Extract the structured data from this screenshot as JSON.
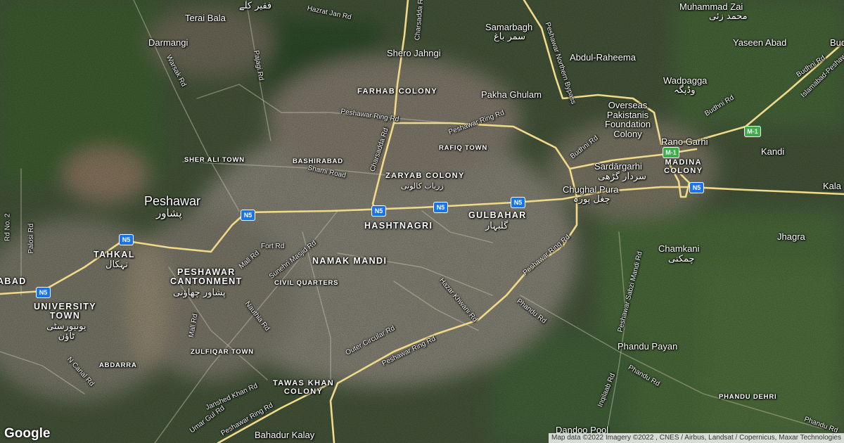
{
  "map": {
    "city": {
      "name": "Peshawar",
      "name_ur": "پشاور"
    },
    "areas": [
      {
        "id": "terai-bala",
        "name": "Terai Bala"
      },
      {
        "id": "faqir-kalay-ur",
        "name": "فقیر کلے"
      },
      {
        "id": "darmangi",
        "name": "Darmangi"
      },
      {
        "id": "samarbagh",
        "name": "Samarbagh",
        "name_ur": "سمر باغ"
      },
      {
        "id": "shero-jahngi",
        "name": "Shero Jahngi"
      },
      {
        "id": "muhammad-zai",
        "name": "Muhammad Zai",
        "name_ur": "محمد زئی"
      },
      {
        "id": "yaseen-abad",
        "name": "Yaseen Abad"
      },
      {
        "id": "abdul-raheema",
        "name": "Abdul-Raheema"
      },
      {
        "id": "wadpagga",
        "name": "Wadpagga",
        "name_ur": "وڈپگہ"
      },
      {
        "id": "farhab-colony",
        "name": "FARHAB COLONY"
      },
      {
        "id": "pakha-ghulam",
        "name": "Pakha Ghulam"
      },
      {
        "id": "opf-colony",
        "name": "Overseas\nPakistanis\nFoundation\nColony"
      },
      {
        "id": "rano-garhi",
        "name": "Rano Garhi"
      },
      {
        "id": "kandi",
        "name": "Kandi"
      },
      {
        "id": "rafiq-town",
        "name": "RAFIQ TOWN"
      },
      {
        "id": "sher-ali-town",
        "name": "SHER ALI TOWN"
      },
      {
        "id": "bashirabad",
        "name": "BASHIRABAD"
      },
      {
        "id": "zaryab-colony",
        "name": "ZARYAB COLONY",
        "name_ur": "زریاب کالونی"
      },
      {
        "id": "sardargarhi",
        "name": "Sardārgarhi",
        "name_ur": "سردار گڑھی"
      },
      {
        "id": "madina-colony",
        "name": "MADINA\nCOLONY"
      },
      {
        "id": "chughal-pura",
        "name": "Chughal Pura",
        "name_ur": "چغل پورہ"
      },
      {
        "id": "kala",
        "name": "Kala"
      },
      {
        "id": "hashtnagri",
        "name": "HASHTNAGRI"
      },
      {
        "id": "gulbahar",
        "name": "GULBAHAR",
        "name_ur": "گلبہار"
      },
      {
        "id": "tahkal",
        "name": "TAHKAL",
        "name_ur": "تہکال"
      },
      {
        "id": "namak-mandi",
        "name": "NAMAK MANDI"
      },
      {
        "id": "jhagra",
        "name": "Jhagra"
      },
      {
        "id": "chamkani",
        "name": "Chamkani",
        "name_ur": "چمکنی"
      },
      {
        "id": "peshawar-cantonment",
        "name": "PESHAWAR\nCANTONMENT",
        "name_ur": "پشاور چھاؤنی"
      },
      {
        "id": "civil-quarters",
        "name": "CIVIL QUARTERS"
      },
      {
        "id": "abad",
        "name": "ABAD"
      },
      {
        "id": "university-town",
        "name": "UNIVERSITY\nTOWN",
        "name_ur": "یونیورسٹی\nٹاؤن"
      },
      {
        "id": "zulfiqar-town",
        "name": "ZULFIQAR TOWN"
      },
      {
        "id": "abdarra",
        "name": "ABDARRA"
      },
      {
        "id": "phandu-payan",
        "name": "Phandu Payan"
      },
      {
        "id": "tawas-khan-colony",
        "name": "TAWAS KHAN\nCOLONY"
      },
      {
        "id": "phandu-dehri",
        "name": "PHANDU DEHRI"
      },
      {
        "id": "bahadur-kalay",
        "name": "Bahadur Kalay"
      },
      {
        "id": "dandoo-pool",
        "name": "Dandoo Pool"
      },
      {
        "id": "bud",
        "name": "Bud"
      }
    ],
    "roads": [
      {
        "id": "hazrat-jan-rd",
        "name": "Hazrat Jan Rd"
      },
      {
        "id": "charsadda-rd-n",
        "name": "Charsadda Rd"
      },
      {
        "id": "peshawar-northern-bypass",
        "name": "Peshawar Northern Bypass"
      },
      {
        "id": "warsak-rd",
        "name": "Warsak Rd"
      },
      {
        "id": "pajagi-rd",
        "name": "Pajagi Rd"
      },
      {
        "id": "budhni-rd-1",
        "name": "Budhni Rd"
      },
      {
        "id": "budhni-rd-2",
        "name": "Budhni Rd"
      },
      {
        "id": "budhni-rd-3",
        "name": "Budhni Rd"
      },
      {
        "id": "islamabad-peshawar",
        "name": "Islamabad-Peshawar"
      },
      {
        "id": "ring-rd-nw",
        "name": "Peshawar Ring Rd"
      },
      {
        "id": "ring-rd-ne",
        "name": "Peshawar Ring Rd"
      },
      {
        "id": "charsadda-rd-s",
        "name": "Charsadda Rd"
      },
      {
        "id": "shami-road",
        "name": "Shami Road"
      },
      {
        "id": "rd-no-2",
        "name": "Rd No. 2"
      },
      {
        "id": "palosi-rd",
        "name": "Palosi Rd"
      },
      {
        "id": "fort-rd",
        "name": "Fort Rd"
      },
      {
        "id": "sunehri-masjid-rd",
        "name": "Sunehri Masjid Rd"
      },
      {
        "id": "mall-rd-1",
        "name": "Mall Rd"
      },
      {
        "id": "mall-rd-2",
        "name": "Mall Rd"
      },
      {
        "id": "ring-rd-e",
        "name": "Peshawar Ring Rd"
      },
      {
        "id": "hazar-khwani-rd",
        "name": "Hazar Khwani Rd"
      },
      {
        "id": "phandu-rd-1",
        "name": "Phandu Rd"
      },
      {
        "id": "phandu-rd-2",
        "name": "Phandu Rd"
      },
      {
        "id": "phandu-rd-3",
        "name": "Phandu Rd"
      },
      {
        "id": "nauthia-rd",
        "name": "Nauthia Rd"
      },
      {
        "id": "outer-circular-rd",
        "name": "Outer Circular Rd"
      },
      {
        "id": "ring-rd-s",
        "name": "Peshawar Ring Rd"
      },
      {
        "id": "ring-rd-sw",
        "name": "Peshawar Ring Rd"
      },
      {
        "id": "sabzi-mandi-rd",
        "name": "Peshawar Sabzi Mandi Rd"
      },
      {
        "id": "n-canal-rd",
        "name": "N Canal Rd"
      },
      {
        "id": "janshed-khan-rd",
        "name": "Janshed Khan Rd"
      },
      {
        "id": "umar-gul-rd",
        "name": "Umar Gul Rd"
      },
      {
        "id": "inqilaab-rd",
        "name": "Inqilaab Rd"
      }
    ],
    "shields": [
      {
        "id": "n5-a",
        "text": "N5"
      },
      {
        "id": "n5-b",
        "text": "N5"
      },
      {
        "id": "n5-c",
        "text": "N5"
      },
      {
        "id": "n5-d",
        "text": "N5"
      },
      {
        "id": "n5-e",
        "text": "N5"
      },
      {
        "id": "n5-f",
        "text": "N5"
      },
      {
        "id": "n5-g",
        "text": "N5"
      },
      {
        "id": "m1-a",
        "text": "M-1"
      },
      {
        "id": "m1-b",
        "text": "M-1"
      }
    ],
    "logo": "Google",
    "attribution": "Map data ©2022 Imagery ©2022 , CNES / Airbus, Landsat / Copernicus, Maxar Technologies",
    "colors": {
      "highway": "#f1d98a",
      "urban": "#8a8878",
      "vegetation": "#4b6a39",
      "shield_national": "#1a73e8",
      "shield_motorway": "#3fae49"
    }
  }
}
